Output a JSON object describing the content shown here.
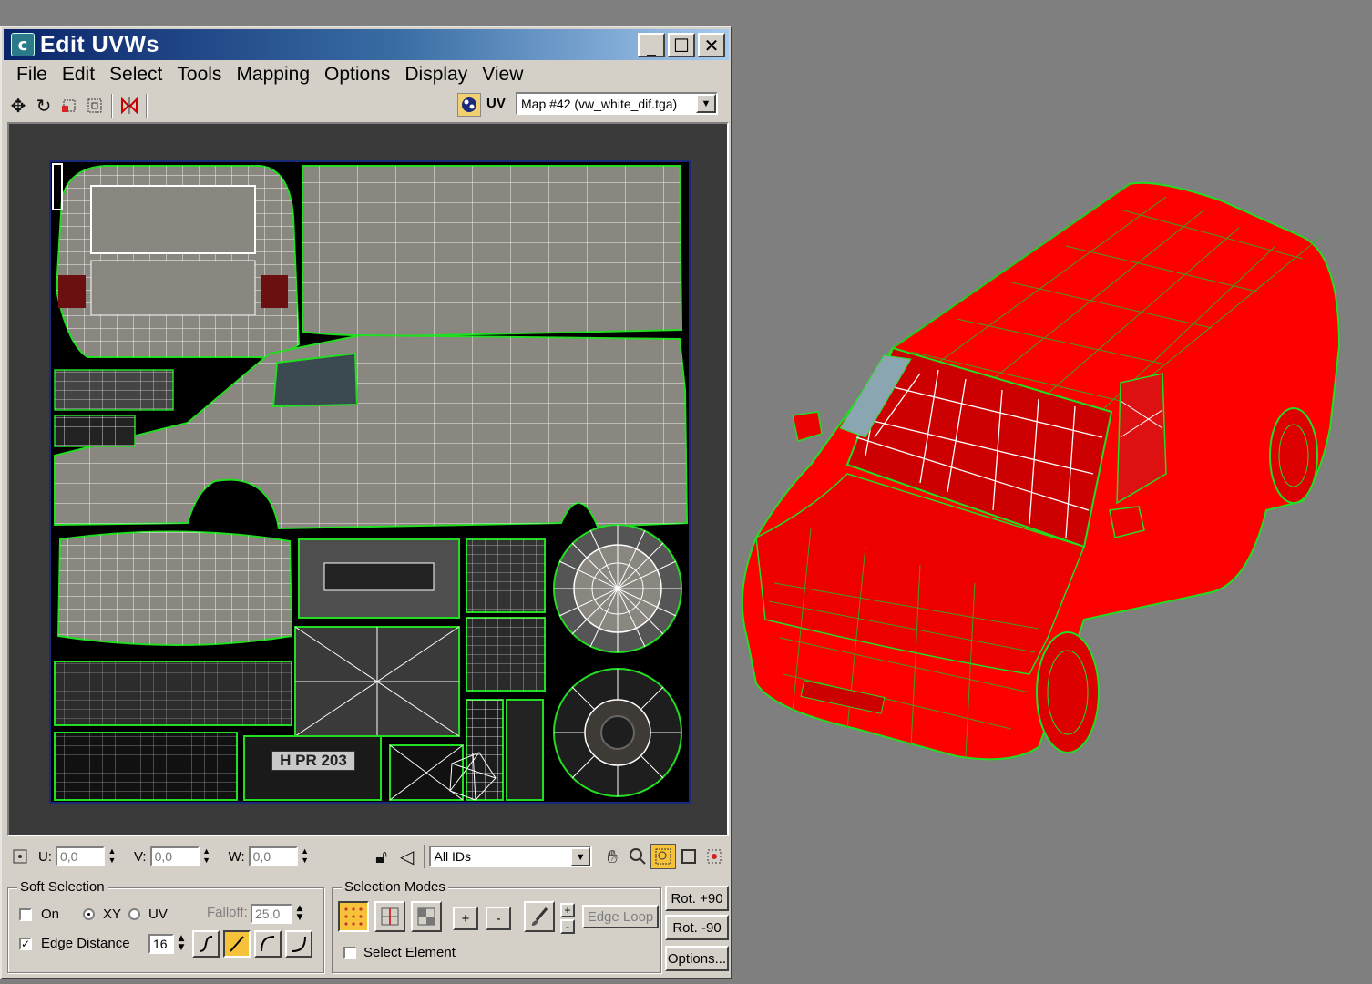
{
  "window": {
    "title": "Edit UVWs",
    "app_icon": "3dsmax-icon",
    "buttons": [
      "_",
      "☐",
      "✕"
    ]
  },
  "menu": [
    "File",
    "Edit",
    "Select",
    "Tools",
    "Mapping",
    "Options",
    "Display",
    "View"
  ],
  "toolbar": {
    "uv_label": "UV",
    "map_select": "Map #42 (vw_white_dif.tga)"
  },
  "uv_canvas": {
    "plate_text": "H PR 203",
    "colors": {
      "background": "#000000",
      "patch_fill": "#8a8680",
      "seam": "#22dd22",
      "edge": "#ffffff"
    }
  },
  "status": {
    "u_label": "U:",
    "u_value": "0,0",
    "v_label": "V:",
    "v_value": "0,0",
    "w_label": "W:",
    "w_value": "0,0",
    "ids_select": "All IDs"
  },
  "soft_selection": {
    "title": "Soft Selection",
    "on_label": "On",
    "xy_label": "XY",
    "uv_label": "UV",
    "falloff_label": "Falloff:",
    "falloff_value": "25,0",
    "edge_distance_label": "Edge Distance",
    "edge_distance_value": "16",
    "edge_distance_checked": "✓"
  },
  "selection_modes": {
    "title": "Selection Modes",
    "plus": "+",
    "minus": "-",
    "edge_loop": "Edge Loop",
    "select_element": "Select Element"
  },
  "rotate": {
    "rot_plus": "Rot. +90",
    "rot_minus": "Rot. -90",
    "options": "Options..."
  },
  "viewport": {
    "object_color": "#ff0000",
    "wire_color": "#22dd22"
  }
}
